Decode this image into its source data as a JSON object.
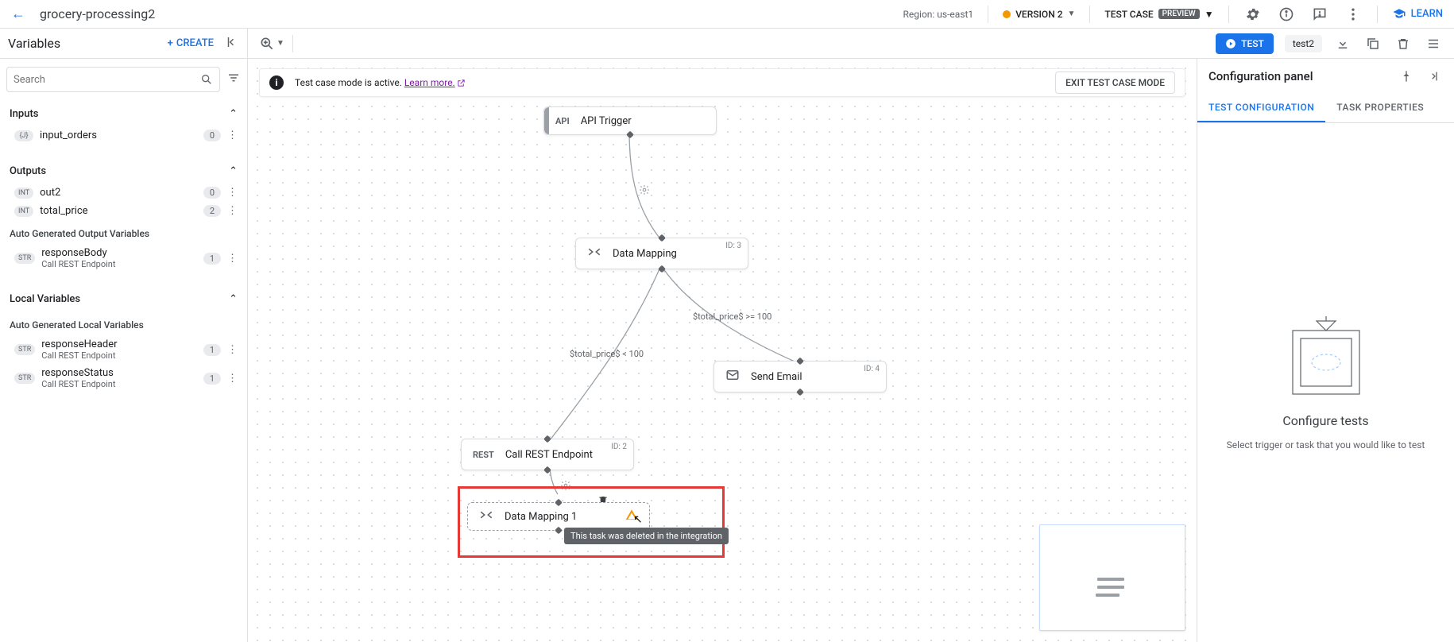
{
  "topbar": {
    "title": "grocery-processing2",
    "region": "Region: us-east1",
    "version": "VERSION 2",
    "testcase_label": "TEST CASE",
    "testcase_badge": "PREVIEW",
    "learn": "LEARN"
  },
  "row2": {
    "variables_header": "Variables",
    "create": "CREATE",
    "test_button": "TEST",
    "test_name": "test2"
  },
  "sidebar": {
    "search_placeholder": "Search",
    "sections": {
      "inputs": "Inputs",
      "outputs": "Outputs",
      "auto_output": "Auto Generated Output Variables",
      "local": "Local Variables",
      "auto_local": "Auto Generated Local Variables"
    },
    "inputs": [
      {
        "type": "{J}",
        "name": "input_orders",
        "count": "0"
      }
    ],
    "outputs": [
      {
        "type": "INT",
        "name": "out2",
        "count": "0"
      },
      {
        "type": "INT",
        "name": "total_price",
        "count": "2"
      }
    ],
    "auto_output": [
      {
        "type": "STR",
        "name": "responseBody",
        "sub": "Call REST Endpoint",
        "count": "1"
      }
    ],
    "auto_local": [
      {
        "type": "STR",
        "name": "responseHeader",
        "sub": "Call REST Endpoint",
        "count": "1"
      },
      {
        "type": "STR",
        "name": "responseStatus",
        "sub": "Call REST Endpoint",
        "count": "1"
      }
    ]
  },
  "notice": {
    "text": "Test case mode is active. ",
    "learn_more": "Learn more.",
    "exit": "EXIT TEST CASE MODE"
  },
  "nodes": {
    "api_trigger": {
      "label": "API Trigger",
      "icon": "API"
    },
    "data_mapping": {
      "label": "Data Mapping",
      "id": "ID: 3"
    },
    "send_email": {
      "label": "Send Email",
      "id": "ID: 4"
    },
    "call_rest": {
      "label": "Call REST Endpoint",
      "id": "ID: 2",
      "icon": "REST"
    },
    "data_mapping_1": {
      "label": "Data Mapping 1"
    }
  },
  "edge_labels": {
    "lt100": "$total_price$ < 100",
    "gte100": "$total_price$ >= 100"
  },
  "tooltip": "This task was deleted in the integration",
  "config": {
    "title": "Configuration panel",
    "tab_test": "TEST CONFIGURATION",
    "tab_task": "TASK PROPERTIES",
    "empty_title": "Configure tests",
    "empty_sub": "Select trigger or task that you would like to test"
  }
}
